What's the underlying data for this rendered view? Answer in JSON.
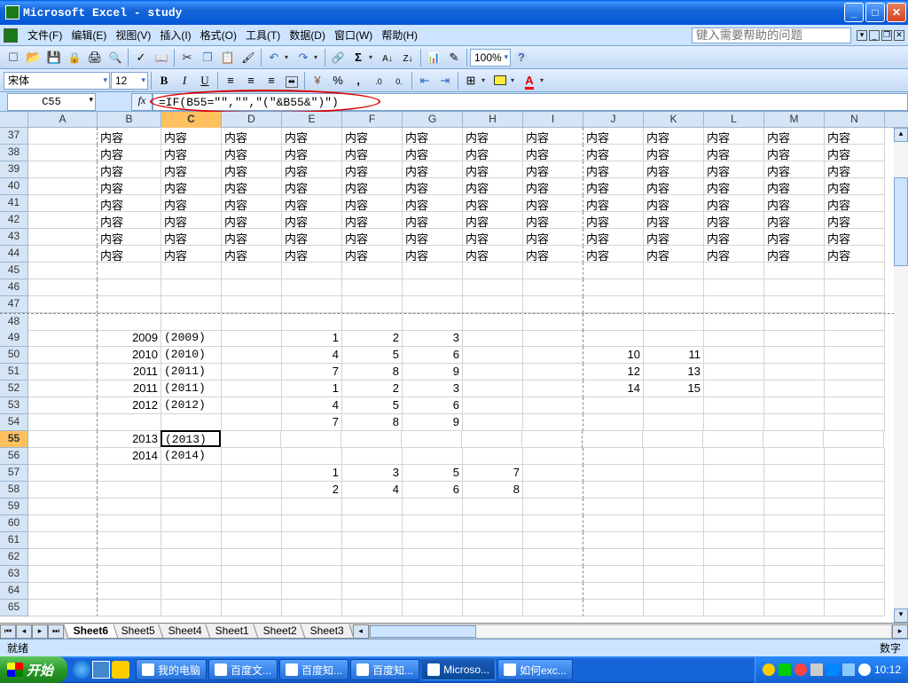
{
  "title": "Microsoft Excel - study",
  "menu": [
    "文件(F)",
    "编辑(E)",
    "视图(V)",
    "插入(I)",
    "格式(O)",
    "工具(T)",
    "数据(D)",
    "窗口(W)",
    "帮助(H)"
  ],
  "help_placeholder": "键入需要帮助的问题",
  "font_name": "宋体",
  "font_size": "12",
  "zoom": "100%",
  "active_cell": "C55",
  "formula": "=IF(B55=\"\",\"\",\"(\"&B55&\")\")",
  "columns": [
    "A",
    "B",
    "C",
    "D",
    "E",
    "F",
    "G",
    "H",
    "I",
    "J",
    "K",
    "L",
    "M",
    "N"
  ],
  "visible_rows": [
    37,
    38,
    39,
    40,
    41,
    42,
    43,
    44,
    45,
    46,
    47,
    48,
    49,
    50,
    51,
    52,
    53,
    54,
    55,
    56,
    57,
    58,
    59,
    60,
    61,
    62,
    63,
    64,
    65
  ],
  "selected_row": 55,
  "selected_col": "C",
  "neirong": "内容",
  "cells": {
    "37-44_B-N": "内容",
    "B49": 2009,
    "C49": "(2009)",
    "E49": 1,
    "F49": 2,
    "G49": 3,
    "B50": 2010,
    "C50": "(2010)",
    "E50": 4,
    "F50": 5,
    "G50": 6,
    "J50": 10,
    "K50": 11,
    "B51": 2011,
    "C51": "(2011)",
    "E51": 7,
    "F51": 8,
    "G51": 9,
    "J51": 12,
    "K51": 13,
    "B52": 2011,
    "C52": "(2011)",
    "E52": 1,
    "F52": 2,
    "G52": 3,
    "J52": 14,
    "K52": 15,
    "B53": 2012,
    "C53": "(2012)",
    "E53": 4,
    "F53": 5,
    "G53": 6,
    "E54": 7,
    "F54": 8,
    "G54": 9,
    "B55": 2013,
    "C55": "(2013)",
    "B56": 2014,
    "C56": "(2014)",
    "E57": 1,
    "F57": 3,
    "G57": 5,
    "H57": 7,
    "E58": 2,
    "F58": 4,
    "G58": 6,
    "H58": 8
  },
  "sheets": [
    "Sheet6",
    "Sheet5",
    "Sheet4",
    "Sheet1",
    "Sheet2",
    "Sheet3"
  ],
  "active_sheet": "Sheet6",
  "status_ready": "就绪",
  "status_num": "数字",
  "start": "开始",
  "tasks": [
    {
      "label": "我的电脑",
      "active": false
    },
    {
      "label": "百度文...",
      "active": false
    },
    {
      "label": "百度知...",
      "active": false
    },
    {
      "label": "百度知...",
      "active": false
    },
    {
      "label": "Microso...",
      "active": true
    },
    {
      "label": "如何exc...",
      "active": false
    }
  ],
  "clock": "10:12"
}
